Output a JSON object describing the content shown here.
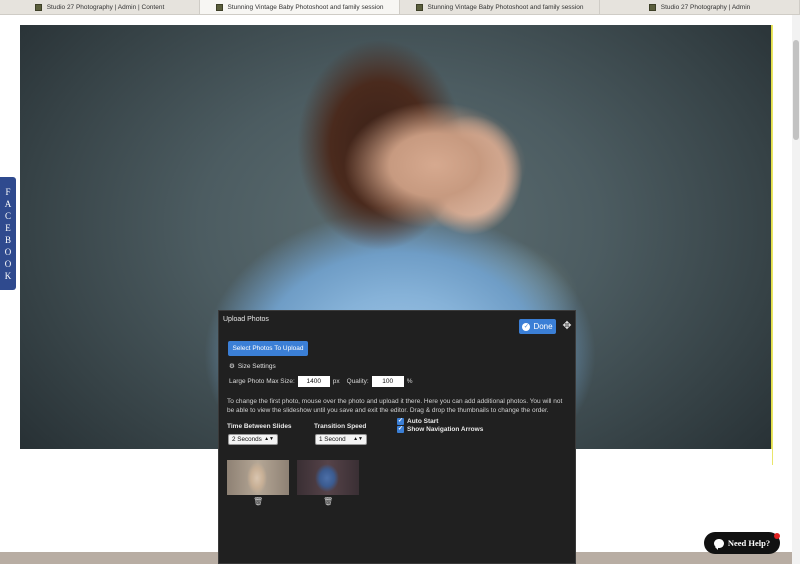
{
  "tabs": [
    {
      "label": "Studio 27 Photography | Admin | Content",
      "active": false
    },
    {
      "label": "Stunning Vintage Baby Photoshoot and family session",
      "active": true
    },
    {
      "label": "Stunning Vintage Baby Photoshoot and family session",
      "active": false
    },
    {
      "label": "Studio 27 Photography | Admin",
      "active": false
    }
  ],
  "side_tab": {
    "letters": [
      "F",
      "A",
      "C",
      "E",
      "B",
      "O",
      "O",
      "K"
    ]
  },
  "upload_panel": {
    "title": "Upload Photos",
    "done_label": "Done",
    "select_button": "Select Photos To Upload",
    "size_settings_label": "Size Settings",
    "max_size_label": "Large Photo Max Size:",
    "max_size_value": "1400",
    "max_size_unit": "px",
    "quality_label": "Quality:",
    "quality_value": "100",
    "quality_unit": "%",
    "help_text": "To change the first photo, mouse over the photo and upload it there. Here you can add additional photos. You will not be able to view the slideshow until you save and exit the editor. Drag & drop the thumbnails to change the order.",
    "time_between_label": "Time Between Slides",
    "time_between_value": "2 Seconds",
    "transition_label": "Transition Speed",
    "transition_value": "1 Second",
    "auto_start_label": "Auto Start",
    "auto_start_checked": true,
    "nav_arrows_label": "Show Navigation Arrows",
    "nav_arrows_checked": true
  },
  "chat": {
    "label": "Need Help?"
  },
  "colors": {
    "accent": "#3b7fd6",
    "panel_bg": "#202020",
    "facebook": "#2f4a8e"
  }
}
